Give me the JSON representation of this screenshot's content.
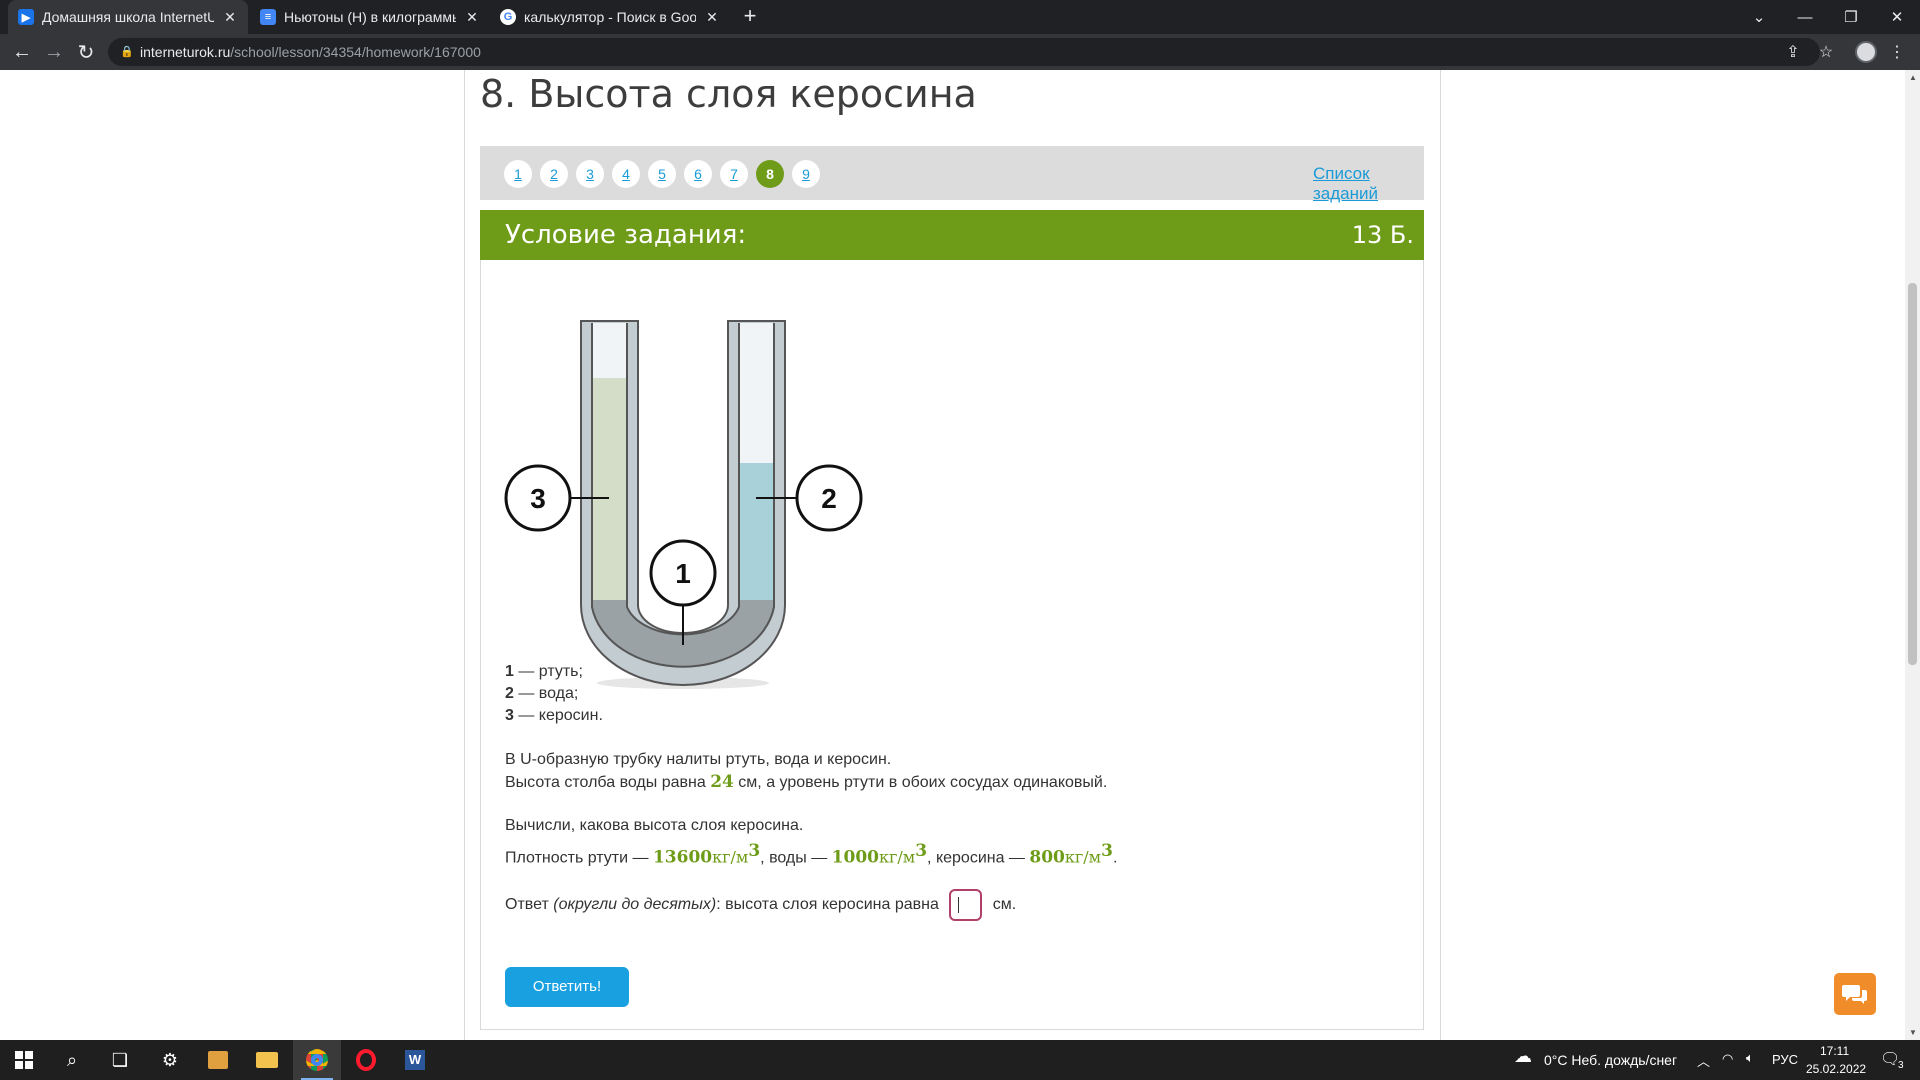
{
  "browser": {
    "tabs": [
      {
        "title": "Домашняя школа InternetUrok.ru",
        "active": true
      },
      {
        "title": "Ньютоны (Н) в килограммы (кг)",
        "active": false
      },
      {
        "title": "калькулятор - Поиск в Google",
        "active": false
      }
    ],
    "url_host": "interneturok.ru",
    "url_path": "/school/lesson/34354/homework/167000"
  },
  "page": {
    "title": "8. Высота слоя керосина",
    "pager": [
      "1",
      "2",
      "3",
      "4",
      "5",
      "6",
      "7",
      "8",
      "9"
    ],
    "current_page": "8",
    "task_list_link": "Список заданий",
    "condition_title": "Условие задания:",
    "points": "13 Б.",
    "diagram_labels": [
      "3",
      "2",
      "1"
    ],
    "legend": [
      {
        "num": "1",
        "text": " — ртуть;"
      },
      {
        "num": "2",
        "text": " — вода;"
      },
      {
        "num": "3",
        "text": " — керосин."
      }
    ],
    "para1_line1": "В U-образную трубку налиты ртуть, вода и керосин.",
    "para1_line2_a": "Высота столба воды равна ",
    "water_height": "24",
    "para1_line2_b": " см, а уровень ртути в обоих сосудах одинаковый.",
    "para2_line1": "Вычисли, какова высота слоя керосина.",
    "density_prefix": "Плотность ртути — ",
    "mercury_density": "13600",
    "unit": "кг/м",
    "unit_power": "3",
    "water_prefix": ", воды — ",
    "water_density": "1000",
    "kerosene_prefix": ", керосина — ",
    "kerosene_density": "800",
    "end_dot": ".",
    "answer_prefix": "Ответ ",
    "answer_hint": "(округли до десятых)",
    "answer_middle": ": высота слоя керосина равна",
    "answer_unit": "см.",
    "submit_label": "Ответить!"
  },
  "taskbar": {
    "weather": "0°C  Неб. дождь/снег",
    "lang": "РУС",
    "time": "17:11",
    "date": "25.02.2022",
    "notifications": "3"
  },
  "colors": {
    "accent_green": "#6e9c19",
    "link_blue": "#1a9bd7",
    "button_blue": "#18a0e0",
    "chat_orange": "#f08c2a"
  }
}
